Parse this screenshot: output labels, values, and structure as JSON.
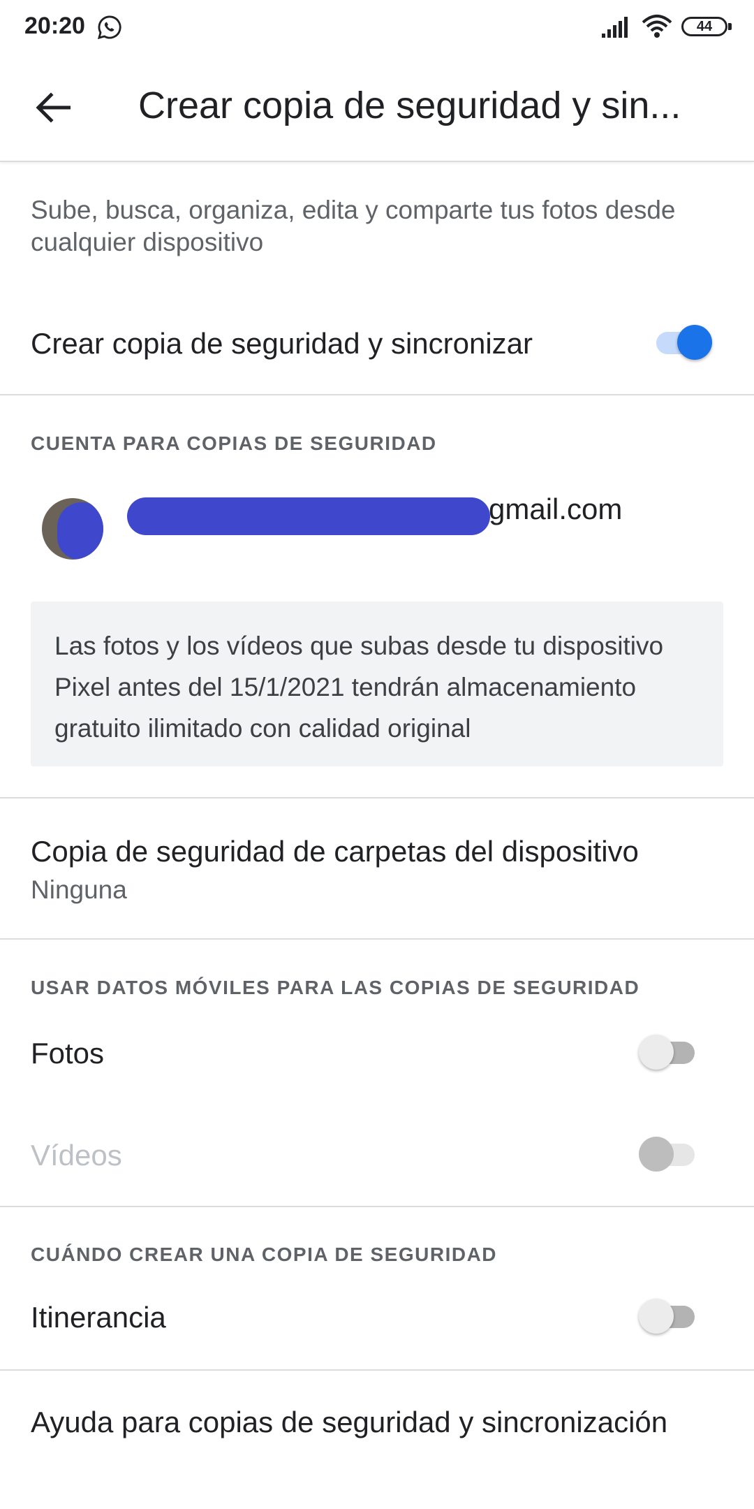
{
  "status_bar": {
    "time": "20:20",
    "battery": "44",
    "icons": [
      "whatsapp-icon",
      "signal-icon",
      "wifi-icon",
      "battery-icon"
    ]
  },
  "app_bar": {
    "back_icon": "arrow-back-icon",
    "title": "Crear copia de seguridad y sin..."
  },
  "description": "Sube, busca, organiza, edita y comparte tus fotos desde cualquier dispositivo",
  "backup_sync": {
    "label": "Crear copia de seguridad y sincronizar",
    "enabled": true
  },
  "account_section": {
    "header": "CUENTA PARA COPIAS DE SEGURIDAD",
    "email_suffix": "gmail.com",
    "info": "Las fotos y los vídeos que subas desde tu dispositivo Pixel antes del 15/1/2021 tendrán almacenamiento gratuito ilimitado con calidad original"
  },
  "device_folders": {
    "label": "Copia de seguridad de carpetas del dispositivo",
    "value": "Ninguna"
  },
  "mobile_data_section": {
    "header": "USAR DATOS MÓVILES PARA LAS COPIAS DE SEGURIDAD",
    "photos_label": "Fotos",
    "photos_enabled": false,
    "videos_label": "Vídeos",
    "videos_enabled": false,
    "videos_disabled": true
  },
  "when_section": {
    "header": "CUÁNDO CREAR UNA COPIA DE SEGURIDAD",
    "roaming_label": "Itinerancia",
    "roaming_enabled": false
  },
  "help": {
    "label": "Ayuda para copias de seguridad y sincronización"
  },
  "colors": {
    "accent": "#1a73e8",
    "accent_track": "#c6dafc",
    "secondary_text": "#5f6368",
    "divider": "#dadce0",
    "info_bg": "#f1f3f4"
  }
}
